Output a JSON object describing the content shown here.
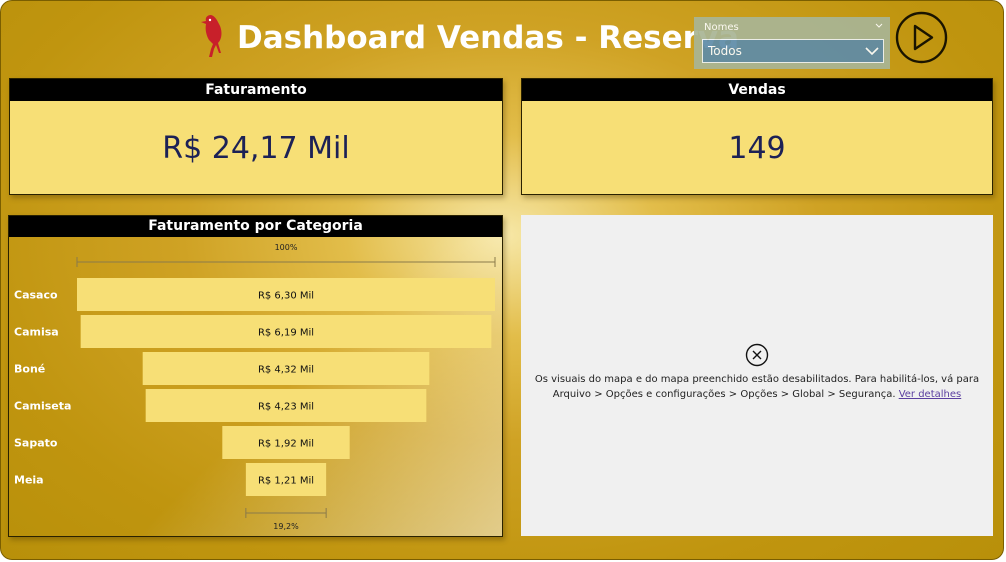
{
  "header": {
    "title": "Dashboard Vendas - Reserva"
  },
  "slicer": {
    "label": "Nomes",
    "value": "Todos"
  },
  "kpis": [
    {
      "title": "Faturamento",
      "value": "R$ 24,17 Mil"
    },
    {
      "title": "Vendas",
      "value": "149"
    }
  ],
  "funnel": {
    "title": "Faturamento por Categoria",
    "top_percent_label": "100%",
    "bottom_percent_label": "19,2%"
  },
  "chart_data": {
    "type": "bar",
    "title": "Faturamento por Categoria",
    "categories": [
      "Casaco",
      "Camisa",
      "Boné",
      "Camiseta",
      "Sapato",
      "Meia"
    ],
    "values": [
      6.3,
      6.19,
      4.32,
      4.23,
      1.92,
      1.21
    ],
    "value_labels": [
      "R$ 6,30 Mil",
      "R$ 6,19 Mil",
      "R$ 4,32 Mil",
      "R$ 4,23 Mil",
      "R$ 1,92 Mil",
      "R$ 1,21 Mil"
    ],
    "bar_color": "#f7df76"
  },
  "map_message": {
    "text": "Os visuais do mapa e do mapa preenchido estão desabilitados. Para habilitá-los, vá para Arquivo > Opções e configurações > Opções > Global > Segurança.",
    "link": "Ver detalhes"
  },
  "colors": {
    "background": "#c0950f",
    "card": "#f7df76",
    "header_bar": "#000000",
    "kpi_text": "#1c2156",
    "brand_red": "#c8202a"
  }
}
